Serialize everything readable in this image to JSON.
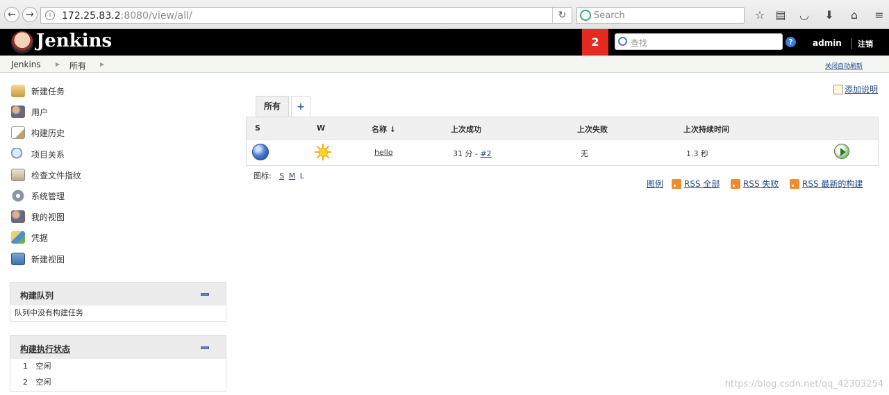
{
  "browser": {
    "url_host": "172.25.83.2",
    "url_rest": ":8080/view/all/",
    "search_placeholder": "Search"
  },
  "header": {
    "logo_text": "Jenkins",
    "notification_count": "2",
    "search_placeholder": "查找",
    "user": "admin",
    "logout": "注销",
    "help_icon": "?"
  },
  "breadcrumb": {
    "items": [
      "Jenkins",
      "所有"
    ],
    "right_link": "关闭自动刷新"
  },
  "sidebar": {
    "items": [
      {
        "label": "新建任务",
        "icon": "new-job-icon"
      },
      {
        "label": "用户",
        "icon": "users-icon"
      },
      {
        "label": "构建历史",
        "icon": "build-history-icon"
      },
      {
        "label": "项目关系",
        "icon": "search-icon"
      },
      {
        "label": "检查文件指纹",
        "icon": "fingerprint-icon"
      },
      {
        "label": "系统管理",
        "icon": "gear-icon"
      },
      {
        "label": "我的视图",
        "icon": "users-icon"
      },
      {
        "label": "凭据",
        "icon": "keys-icon"
      },
      {
        "label": "新建视图",
        "icon": "folder-icon"
      }
    ]
  },
  "build_queue": {
    "title": "构建队列",
    "empty_text": "队列中没有构建任务"
  },
  "executors": {
    "title": "构建执行状态",
    "rows": [
      {
        "num": "1",
        "status": "空闲"
      },
      {
        "num": "2",
        "status": "空闲"
      }
    ]
  },
  "main": {
    "add_description": "添加说明",
    "tab_active": "所有",
    "tab_add": "+",
    "columns": {
      "s": "S",
      "w": "W",
      "name": "名称 ↓",
      "last_success": "上次成功",
      "last_failure": "上次失败",
      "last_duration": "上次持续时间"
    },
    "job": {
      "name": "hello",
      "last_success_prefix": "31 分 - ",
      "last_success_link": "#2",
      "last_failure": "无",
      "last_duration": "1.3 秒"
    },
    "icon_size_label": "图标:",
    "icon_sizes": [
      "S",
      "M",
      "L"
    ],
    "legend": "图例",
    "rss_all": "RSS 全部",
    "rss_failed": "RSS 失败",
    "rss_latest": "RSS 最新的构建"
  },
  "watermark": "https://blog.csdn.net/qq_42303254"
}
